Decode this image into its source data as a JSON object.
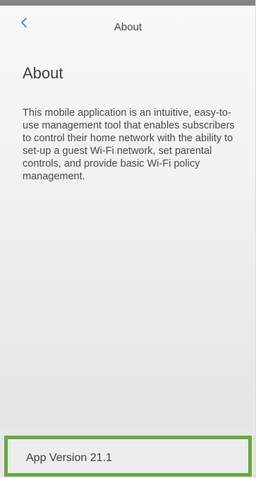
{
  "theme": {
    "accent": "#1e88e5",
    "highlight": "#69a848",
    "top_rule": "#858585"
  },
  "header": {
    "back_icon": "back-chevron-icon",
    "title": "About"
  },
  "content": {
    "heading": "About",
    "description": "This mobile application is an intuitive, easy-to-use management tool that enables subscribers to control their home network with the ability to set-up a guest Wi-Fi network, set parental controls, and provide basic Wi-Fi policy management."
  },
  "footer": {
    "version": "App Version 21.1"
  }
}
